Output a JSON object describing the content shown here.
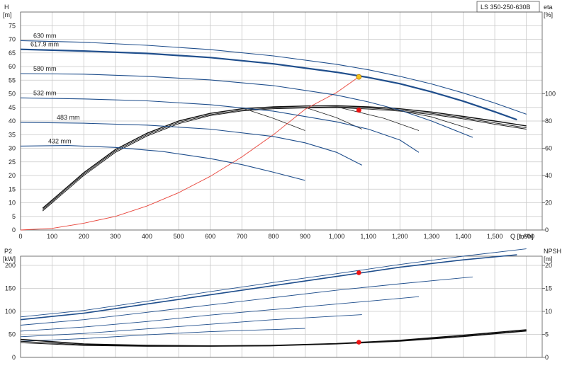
{
  "pump_label": "LS 350-250-630B",
  "chart_data": [
    {
      "type": "line",
      "name": "head",
      "left_axis_title": [
        "H",
        "[m]"
      ],
      "right_axis_title": [
        "eta",
        "[%]"
      ],
      "xlabel": "Q [m³/h]",
      "xlim": [
        0,
        1650
      ],
      "ylim": [
        0,
        80
      ],
      "x_ticks": [
        0,
        100,
        200,
        300,
        400,
        500,
        600,
        700,
        800,
        900,
        1000,
        1100,
        1200,
        1300,
        1400,
        1500,
        1600
      ],
      "x_tick_labels": [
        "0",
        "100",
        "200",
        "300",
        "400",
        "500",
        "600",
        "700",
        "800",
        "900",
        "1,000",
        "1,100",
        "1,200",
        "1,300",
        "1,400",
        "1,500",
        "1,600"
      ],
      "y_ticks": [
        0,
        5,
        10,
        15,
        20,
        25,
        30,
        35,
        40,
        45,
        50,
        55,
        60,
        65,
        70,
        75
      ],
      "right_ticks": [
        0,
        20,
        40,
        60,
        80,
        100
      ],
      "right_range": [
        0,
        160
      ],
      "grid": true,
      "series": [
        {
          "name": "630 mm",
          "x": [
            0,
            200,
            400,
            600,
            800,
            1000,
            1100,
            1200,
            1300,
            1400,
            1500,
            1600
          ],
          "y": [
            69.5,
            68.9,
            67.8,
            66.2,
            63.9,
            60.8,
            58.8,
            56.4,
            53.6,
            50.3,
            46.6,
            42.5
          ]
        },
        {
          "name": "617.9 mm",
          "x": [
            0,
            200,
            400,
            600,
            800,
            1000,
            1100,
            1200,
            1300,
            1400,
            1500,
            1570
          ],
          "y": [
            66.3,
            65.7,
            64.8,
            63.3,
            61.0,
            57.9,
            56.0,
            53.7,
            50.7,
            47.3,
            43.4,
            40.5
          ]
        },
        {
          "name": "580 mm",
          "x": [
            0,
            200,
            400,
            600,
            800,
            1000,
            1100,
            1200,
            1300,
            1400,
            1430
          ],
          "y": [
            57.4,
            57.2,
            56.4,
            55.1,
            53.0,
            49.5,
            47.0,
            44.0,
            40.0,
            35.4,
            34.0
          ]
        },
        {
          "name": "532 mm",
          "x": [
            0,
            200,
            400,
            600,
            800,
            1000,
            1100,
            1200,
            1260
          ],
          "y": [
            48.5,
            48.1,
            47.4,
            46.0,
            43.6,
            39.7,
            37.0,
            33.0,
            28.5
          ]
        },
        {
          "name": "483 mm",
          "x": [
            0,
            200,
            400,
            600,
            800,
            900,
            1000,
            1080
          ],
          "y": [
            39.5,
            39.2,
            38.5,
            37.0,
            34.3,
            32.0,
            28.5,
            23.8
          ]
        },
        {
          "name": "432 mm",
          "x": [
            0,
            150,
            300,
            450,
            600,
            700,
            800,
            900
          ],
          "y": [
            30.8,
            31.0,
            30.3,
            28.8,
            26.2,
            24.0,
            21.2,
            18.2
          ]
        }
      ],
      "system_curve": {
        "x": [
          0,
          100,
          200,
          300,
          400,
          500,
          600,
          700,
          800,
          900,
          1000,
          1070
        ],
        "y": [
          0,
          0.6,
          2.5,
          5.0,
          8.8,
          13.7,
          19.7,
          26.8,
          35.0,
          44.3,
          50.5,
          56.2
        ]
      },
      "efficiency_curves": {
        "x": [
          70,
          100,
          150,
          200,
          300,
          400,
          500,
          600,
          700,
          800,
          900,
          1000,
          1100,
          1200,
          1300,
          1400,
          1500,
          1600
        ],
        "curves": [
          [
            8.0,
            11.0,
            16.0,
            21.0,
            29.5,
            35.5,
            40.0,
            42.8,
            44.5,
            45.2,
            45.5,
            45.6,
            45.2,
            44.5,
            43.3,
            41.7,
            40.0,
            38.2
          ],
          [
            7.5,
            10.5,
            15.5,
            20.5,
            29.0,
            35.0,
            39.5,
            42.3,
            44.0,
            44.8,
            45.0,
            45.2,
            44.8,
            44.0,
            42.8,
            41.2,
            39.3,
            37.5
          ],
          [
            7.0,
            10.0,
            15.0,
            20.0,
            28.5,
            34.5,
            39.0,
            42.0,
            43.7,
            44.5,
            44.8,
            44.9,
            44.4,
            43.6,
            42.4,
            40.8,
            38.8,
            37.0
          ]
        ]
      },
      "efficiency_tails": [
        {
          "x": [
            700,
            800,
            900
          ],
          "y": [
            44.8,
            41.0,
            36.5
          ]
        },
        {
          "x": [
            900,
            1000,
            1080
          ],
          "y": [
            45.0,
            41.2,
            37.0
          ]
        },
        {
          "x": [
            1000,
            1150,
            1260
          ],
          "y": [
            45.2,
            41.0,
            36.5
          ]
        },
        {
          "x": [
            1150,
            1300,
            1430
          ],
          "y": [
            45.0,
            41.5,
            36.8
          ]
        }
      ],
      "markers": [
        {
          "x": 1070,
          "y": 56.2,
          "color": "#f2c21b"
        },
        {
          "x": 1070,
          "y": 44.0,
          "color": "#ee1111"
        }
      ]
    },
    {
      "type": "line",
      "name": "power",
      "left_axis_title": [
        "P2",
        "[kW]"
      ],
      "right_axis_title": [
        "NPSH",
        "[m]"
      ],
      "xlim": [
        0,
        1650
      ],
      "ylim": [
        0,
        220
      ],
      "y_ticks": [
        0,
        50,
        100,
        150,
        200
      ],
      "right_ticks": [
        0,
        5,
        10,
        15,
        20
      ],
      "right_range": [
        0,
        22
      ],
      "grid": true,
      "series": [
        {
          "name": "630 mm",
          "x": [
            0,
            200,
            400,
            600,
            800,
            1000,
            1200,
            1400,
            1600
          ],
          "y": [
            88,
            102,
            122,
            143,
            163,
            182,
            202,
            220,
            236
          ]
        },
        {
          "name": "617.9 mm",
          "x": [
            0,
            200,
            400,
            600,
            800,
            1000,
            1200,
            1400,
            1570
          ],
          "y": [
            82,
            96,
            116,
            136,
            156,
            176,
            196,
            212,
            223
          ]
        },
        {
          "name": "580 mm",
          "x": [
            0,
            200,
            400,
            600,
            800,
            1000,
            1200,
            1430
          ],
          "y": [
            70,
            82,
            98,
            114,
            130,
            146,
            160,
            175
          ]
        },
        {
          "name": "532 mm",
          "x": [
            0,
            200,
            400,
            600,
            800,
            1000,
            1260
          ],
          "y": [
            57,
            66,
            78,
            92,
            104,
            116,
            132
          ]
        },
        {
          "name": "483 mm",
          "x": [
            0,
            200,
            400,
            600,
            800,
            1080
          ],
          "y": [
            45,
            52,
            62,
            72,
            82,
            93
          ]
        },
        {
          "name": "432 mm",
          "x": [
            0,
            200,
            400,
            600,
            900
          ],
          "y": [
            35,
            41,
            49,
            56,
            63
          ]
        }
      ],
      "npsh_curves": {
        "x": [
          0,
          200,
          400,
          600,
          800,
          1000,
          1200,
          1400,
          1600
        ],
        "curves": [
          [
            3.9,
            2.9,
            2.6,
            2.5,
            2.6,
            3.0,
            3.7,
            4.8,
            6.0
          ],
          [
            3.5,
            2.7,
            2.5,
            2.5,
            2.6,
            3.0,
            3.6,
            4.6,
            5.8
          ],
          [
            3.2,
            2.6,
            2.4,
            2.4,
            2.5,
            2.9,
            3.5,
            4.5,
            5.7
          ]
        ]
      },
      "markers": [
        {
          "x": 1070,
          "y": 184,
          "color": "#ee1111"
        },
        {
          "x": 1070,
          "y": 33,
          "color": "#ee1111"
        }
      ]
    }
  ]
}
